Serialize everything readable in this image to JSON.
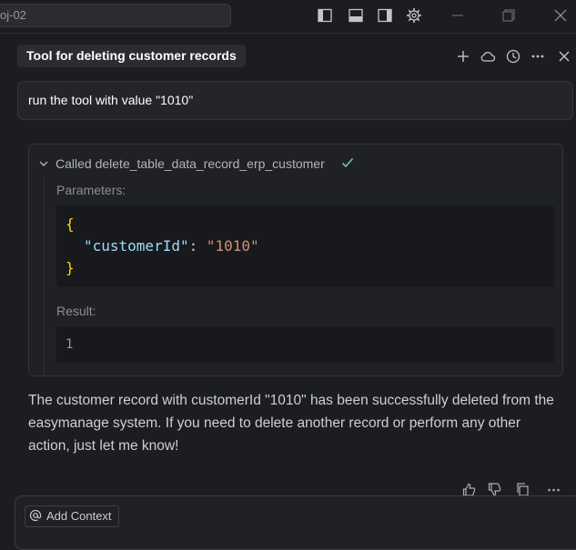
{
  "titlebar": {
    "search_text": "oj-02",
    "icons": [
      "toggle-primary-sidebar-icon",
      "toggle-panel-icon",
      "toggle-secondary-sidebar-icon",
      "gear-icon",
      "minimize-icon",
      "restore-icon",
      "close-icon"
    ]
  },
  "chat": {
    "title": "Tool for deleting customer records",
    "header_icons": [
      "plus-icon",
      "cloud-icon",
      "history-icon",
      "more-icon",
      "close-icon"
    ]
  },
  "user_message": "run the tool with value \"1010\"",
  "tool_call": {
    "label": "Called delete_table_data_record_erp_customer",
    "status": "success",
    "parameters_label": "Parameters:",
    "code": {
      "open_brace": "{",
      "key": "\"customerId\"",
      "colon": ": ",
      "value": "\"1010\"",
      "close_brace": "}"
    },
    "result_label": "Result:",
    "result_value": "1"
  },
  "response_text": "The customer record with customerId \"1010\" has been successfully deleted from the easymanage system. If you need to delete another record or perform any other action, just let me know!",
  "footer_actions": [
    "thumbs-up-icon",
    "thumbs-down-icon",
    "copy-icon",
    "more-icon"
  ],
  "input": {
    "add_context_label": "Add Context"
  },
  "colors": {
    "background": "#1b1d23",
    "card": "#1f2127",
    "success": "#73c991",
    "json_brace": "#ffd700",
    "json_key": "#9cdcfe",
    "json_string": "#ce9178"
  }
}
